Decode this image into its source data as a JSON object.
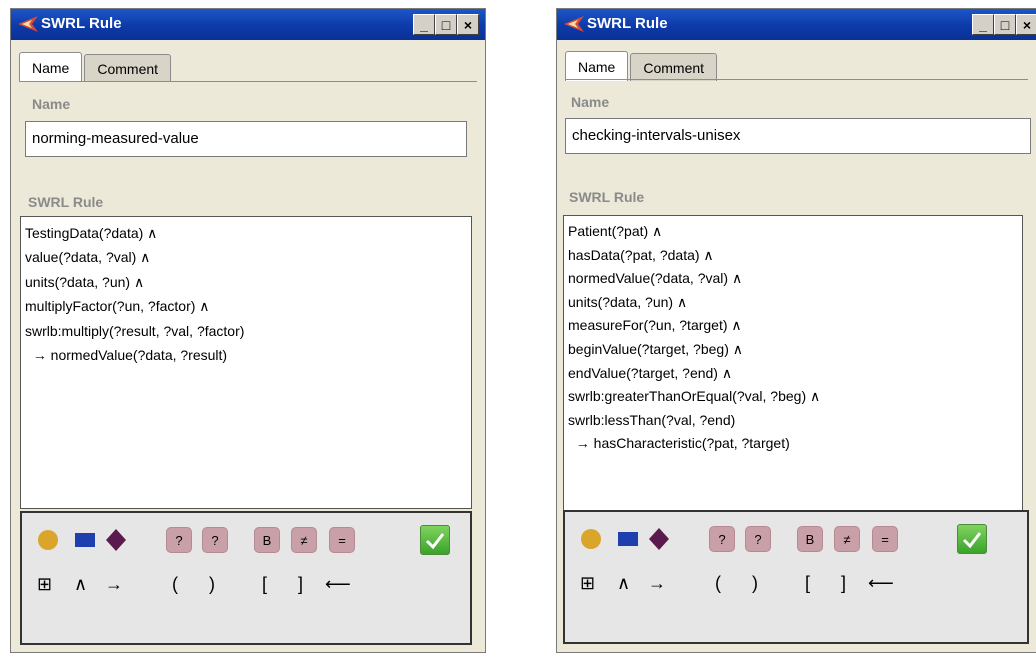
{
  "windows": [
    {
      "title": "SWRL Rule",
      "tabs": [
        "Name",
        "Comment"
      ],
      "name_label": "Name",
      "name_value": "norming-measured-value",
      "rule_label": "SWRL Rule",
      "rule_lines": [
        "TestingData(?data)  ∧",
        "value(?data, ?val)  ∧",
        "units(?data, ?un)  ∧",
        "multiplyFactor(?un, ?factor)  ∧",
        "swrlb:multiply(?result, ?val, ?factor)",
        "  → normedValue(?data, ?result)"
      ]
    },
    {
      "title": "SWRL Rule",
      "tabs": [
        "Name",
        "Comment"
      ],
      "name_label": "Name",
      "name_value": "checking-intervals-unisex",
      "rule_label": "SWRL Rule",
      "rule_lines": [
        "Patient(?pat)  ∧",
        "hasData(?pat, ?data)  ∧",
        "normedValue(?data, ?val)  ∧",
        "units(?data, ?un)  ∧",
        "measureFor(?un, ?target)  ∧",
        "beginValue(?target, ?beg)  ∧",
        "endValue(?target, ?end)  ∧",
        "swrlb:greaterThanOrEqual(?val, ?beg)  ∧",
        "swrlb:lessThan(?val, ?end)",
        "  → hasCharacteristic(?pat, ?target)"
      ]
    }
  ],
  "window_buttons": [
    "_",
    "□",
    "×"
  ],
  "toolbox": {
    "row1": {
      "class_icon": "circle-icon",
      "property_icon": "rectangle-icon",
      "individual_icon": "diamond-icon",
      "variable_label": "?",
      "new_variable_label": "?",
      "builtin_label": "B",
      "different_label": "≠",
      "same_label": "=",
      "ok_icon": "checkmark-icon"
    },
    "row2": {
      "grid_symbol": "⊞",
      "and_symbol": "∧",
      "implies_symbol": "→",
      "lparen": "(",
      "rparen": ")",
      "lbracket": "[",
      "rbracket": "]",
      "delete_symbol": "⟵"
    }
  },
  "colors": {
    "title_bar": "#0d3aa8",
    "class_circle": "#d9a52a",
    "property_rect": "#1e3fae",
    "individual_diamond": "#5a1a4e",
    "pink_button": "#caa0a8",
    "ok_green": "#3aa32a"
  }
}
